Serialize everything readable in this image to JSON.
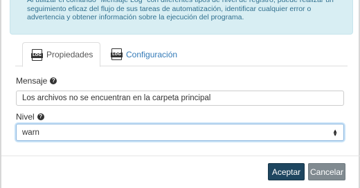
{
  "info": {
    "text": "Al utilizar el comando \"Mensaje Log\" con diferentes tipos de nivel de registro, puede realizar un seguimiento eficaz del flujo de sus tareas de automatización, identificar cualquier error o advertencia y obtener información sobre la ejecución del programa."
  },
  "tabs": [
    {
      "label": "Propiedades",
      "icon": "log-icon",
      "active": true
    },
    {
      "label": "Configuración",
      "icon": "log-icon",
      "active": false
    }
  ],
  "icon_text": "LOG",
  "form": {
    "message_label": "Mensaje",
    "message_value": "Los archivos no se encuentran en la carpeta principal",
    "level_label": "Nivel",
    "level_value": "warn"
  },
  "buttons": {
    "ok": "Aceptar",
    "cancel": "Cancelar"
  },
  "colors": {
    "info_bg": "#d8eef3",
    "primary_button": "#1e4660",
    "secondary_button": "#808a90",
    "link": "#337ab7"
  }
}
